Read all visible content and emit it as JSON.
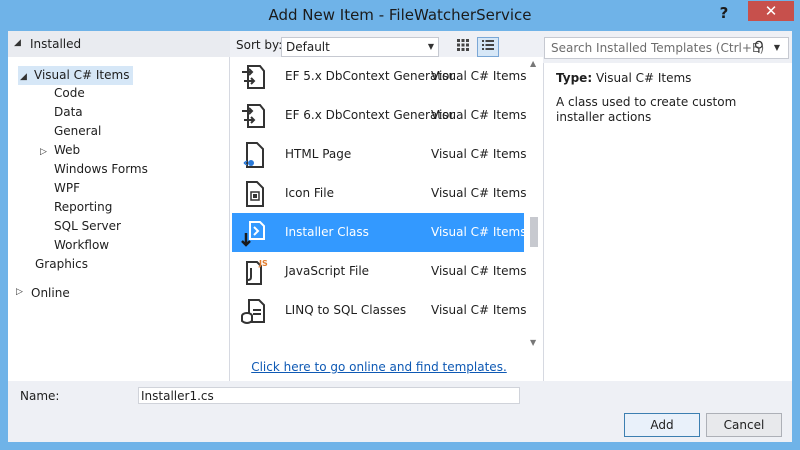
{
  "window": {
    "title": "Add New Item - FileWatcherService",
    "help": "?",
    "close": "✕"
  },
  "tree": {
    "header": "Installed",
    "items": [
      {
        "label": "Visual C# Items"
      },
      {
        "label": "Code"
      },
      {
        "label": "Data"
      },
      {
        "label": "General"
      },
      {
        "label": "Web"
      },
      {
        "label": "Windows Forms"
      },
      {
        "label": "WPF"
      },
      {
        "label": "Reporting"
      },
      {
        "label": "SQL Server"
      },
      {
        "label": "Workflow"
      },
      {
        "label": "Graphics"
      }
    ],
    "online": "Online"
  },
  "toolbar": {
    "sort_label": "Sort by:",
    "sort_value": "Default"
  },
  "search": {
    "placeholder": "Search Installed Templates (Ctrl+E)"
  },
  "templates": [
    {
      "name": "EF 5.x DbContext Generator",
      "category": "Visual C# Items",
      "icon": "ef-generator-icon"
    },
    {
      "name": "EF 6.x DbContext Generator",
      "category": "Visual C# Items",
      "icon": "ef-generator-icon"
    },
    {
      "name": "HTML Page",
      "category": "Visual C# Items",
      "icon": "html-page-icon"
    },
    {
      "name": "Icon File",
      "category": "Visual C# Items",
      "icon": "icon-file-icon"
    },
    {
      "name": "Installer Class",
      "category": "Visual C# Items",
      "icon": "installer-class-icon"
    },
    {
      "name": "JavaScript File",
      "category": "Visual C# Items",
      "icon": "javascript-file-icon"
    },
    {
      "name": "LINQ to SQL Classes",
      "category": "Visual C# Items",
      "icon": "linq-sql-icon"
    }
  ],
  "online_link": "Click here to go online and find templates.",
  "details": {
    "type_label": "Type:",
    "type_value": "Visual C# Items",
    "description": "A class used to create custom installer actions"
  },
  "bottom": {
    "name_label": "Name:",
    "name_value": "Installer1.cs",
    "add": "Add",
    "cancel": "Cancel"
  },
  "colors": {
    "accent": "#3399ff",
    "title_bar": "#6fb3e8",
    "close": "#c7504c",
    "link": "#0e59b4"
  }
}
